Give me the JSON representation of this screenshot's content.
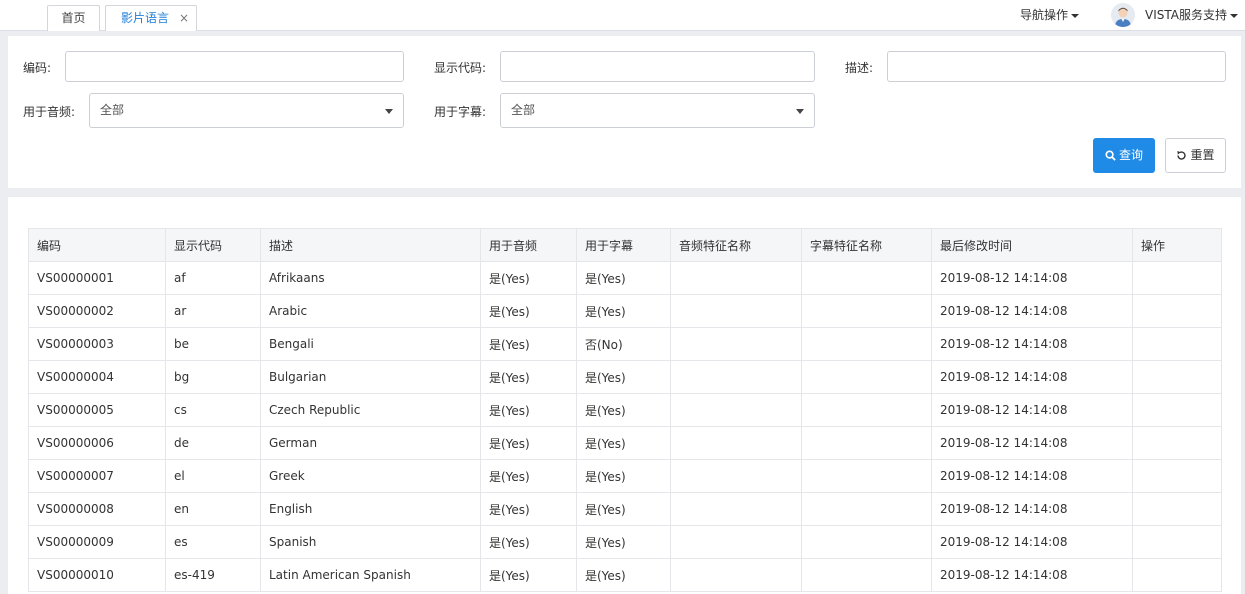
{
  "tabs": [
    {
      "label": "首页",
      "active": false
    },
    {
      "label": "影片语言",
      "active": true,
      "close": "×"
    }
  ],
  "header": {
    "nav_ops": "导航操作",
    "user_name": "VISTA服务支持"
  },
  "filters": {
    "code_label": "编码:",
    "display_code_label": "显示代码:",
    "desc_label": "描述:",
    "audio_label": "用于音频:",
    "audio_value": "全部",
    "subtitle_label": "用于字幕:",
    "subtitle_value": "全部",
    "search_label": "查询",
    "reset_label": "重置"
  },
  "colors": {
    "accent": "#1f8be6",
    "active_tab_text": "#1f7ed6"
  },
  "table": {
    "columns": [
      "编码",
      "显示代码",
      "描述",
      "用于音频",
      "用于字幕",
      "音频特征名称",
      "字幕特征名称",
      "最后修改时间",
      "操作"
    ],
    "rows": [
      [
        "VS00000001",
        "af",
        "Afrikaans",
        "是(Yes)",
        "是(Yes)",
        "",
        "",
        "2019-08-12 14:14:08",
        ""
      ],
      [
        "VS00000002",
        "ar",
        "Arabic",
        "是(Yes)",
        "是(Yes)",
        "",
        "",
        "2019-08-12 14:14:08",
        ""
      ],
      [
        "VS00000003",
        "be",
        "Bengali",
        "是(Yes)",
        "否(No)",
        "",
        "",
        "2019-08-12 14:14:08",
        ""
      ],
      [
        "VS00000004",
        "bg",
        "Bulgarian",
        "是(Yes)",
        "是(Yes)",
        "",
        "",
        "2019-08-12 14:14:08",
        ""
      ],
      [
        "VS00000005",
        "cs",
        "Czech Republic",
        "是(Yes)",
        "是(Yes)",
        "",
        "",
        "2019-08-12 14:14:08",
        ""
      ],
      [
        "VS00000006",
        "de",
        "German",
        "是(Yes)",
        "是(Yes)",
        "",
        "",
        "2019-08-12 14:14:08",
        ""
      ],
      [
        "VS00000007",
        "el",
        "Greek",
        "是(Yes)",
        "是(Yes)",
        "",
        "",
        "2019-08-12 14:14:08",
        ""
      ],
      [
        "VS00000008",
        "en",
        "English",
        "是(Yes)",
        "是(Yes)",
        "",
        "",
        "2019-08-12 14:14:08",
        ""
      ],
      [
        "VS00000009",
        "es",
        "Spanish",
        "是(Yes)",
        "是(Yes)",
        "",
        "",
        "2019-08-12 14:14:08",
        ""
      ],
      [
        "VS00000010",
        "es-419",
        "Latin American Spanish",
        "是(Yes)",
        "是(Yes)",
        "",
        "",
        "2019-08-12 14:14:08",
        ""
      ]
    ]
  }
}
